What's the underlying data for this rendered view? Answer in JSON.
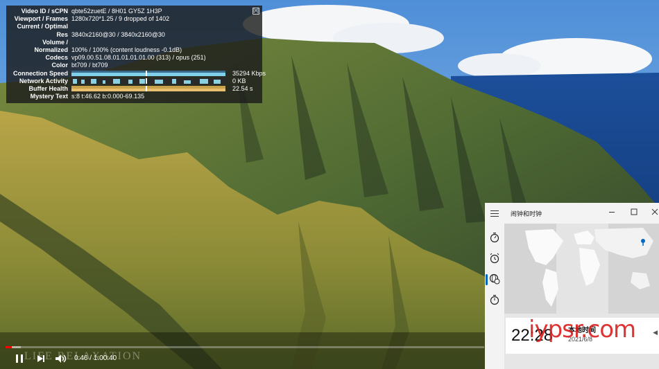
{
  "stats": {
    "close_label": "[x]",
    "rows": [
      {
        "key": "Video ID / sCPN",
        "value": "qbte52zuetE / 8H01 GY5Z 1H3P"
      },
      {
        "key": "Viewport / Frames",
        "value": "1280x720*1.25 / 9 dropped of 1402"
      },
      {
        "key": "Current / Optimal",
        "value": ""
      },
      {
        "key": "Res",
        "value": "3840x2160@30 / 3840x2160@30"
      },
      {
        "key": "Volume /",
        "value": ""
      },
      {
        "key": "Normalized",
        "value": "100% / 100% (content loudness -0.1dB)"
      },
      {
        "key": "Codecs",
        "value": "vp09.00.51.08.01.01.01.01.00 (313) / opus (251)"
      },
      {
        "key": "Color",
        "value": "bt709 / bt709"
      }
    ],
    "graphs": [
      {
        "key": "Connection Speed",
        "value": "35294 Kbps"
      },
      {
        "key": "Network Activity",
        "value": "0 KB"
      },
      {
        "key": "Buffer Health",
        "value": "22.54 s"
      }
    ],
    "mystery": {
      "key": "Mystery Text",
      "value": "s:8 t:46.62 b:0.000-69.135"
    }
  },
  "player": {
    "current_time": "0:46",
    "duration": "1:00:40",
    "time_display": "0:46 / 1:00:40",
    "played_fraction": 0.013,
    "buffered_fraction": 0.032,
    "icons": [
      "play-pause-icon",
      "next-icon",
      "volume-icon"
    ],
    "watermark": "LIFE RELAXATION"
  },
  "clock_app": {
    "title": "闹钟和时钟",
    "nav_icons": [
      "menu-icon",
      "timer-icon",
      "alarm-icon",
      "world-clock-icon",
      "stopwatch-icon"
    ],
    "active_nav": "world-clock-icon",
    "local_time": "22:28",
    "local_label": "本地时间",
    "local_date": "2021/6/8",
    "more_label": "◀"
  },
  "overlay_watermark": "iypsr.com",
  "colors": {
    "accent_red": "#ff0000",
    "windows_blue": "#0067c0",
    "stats_bg": "#1c1c1c"
  }
}
